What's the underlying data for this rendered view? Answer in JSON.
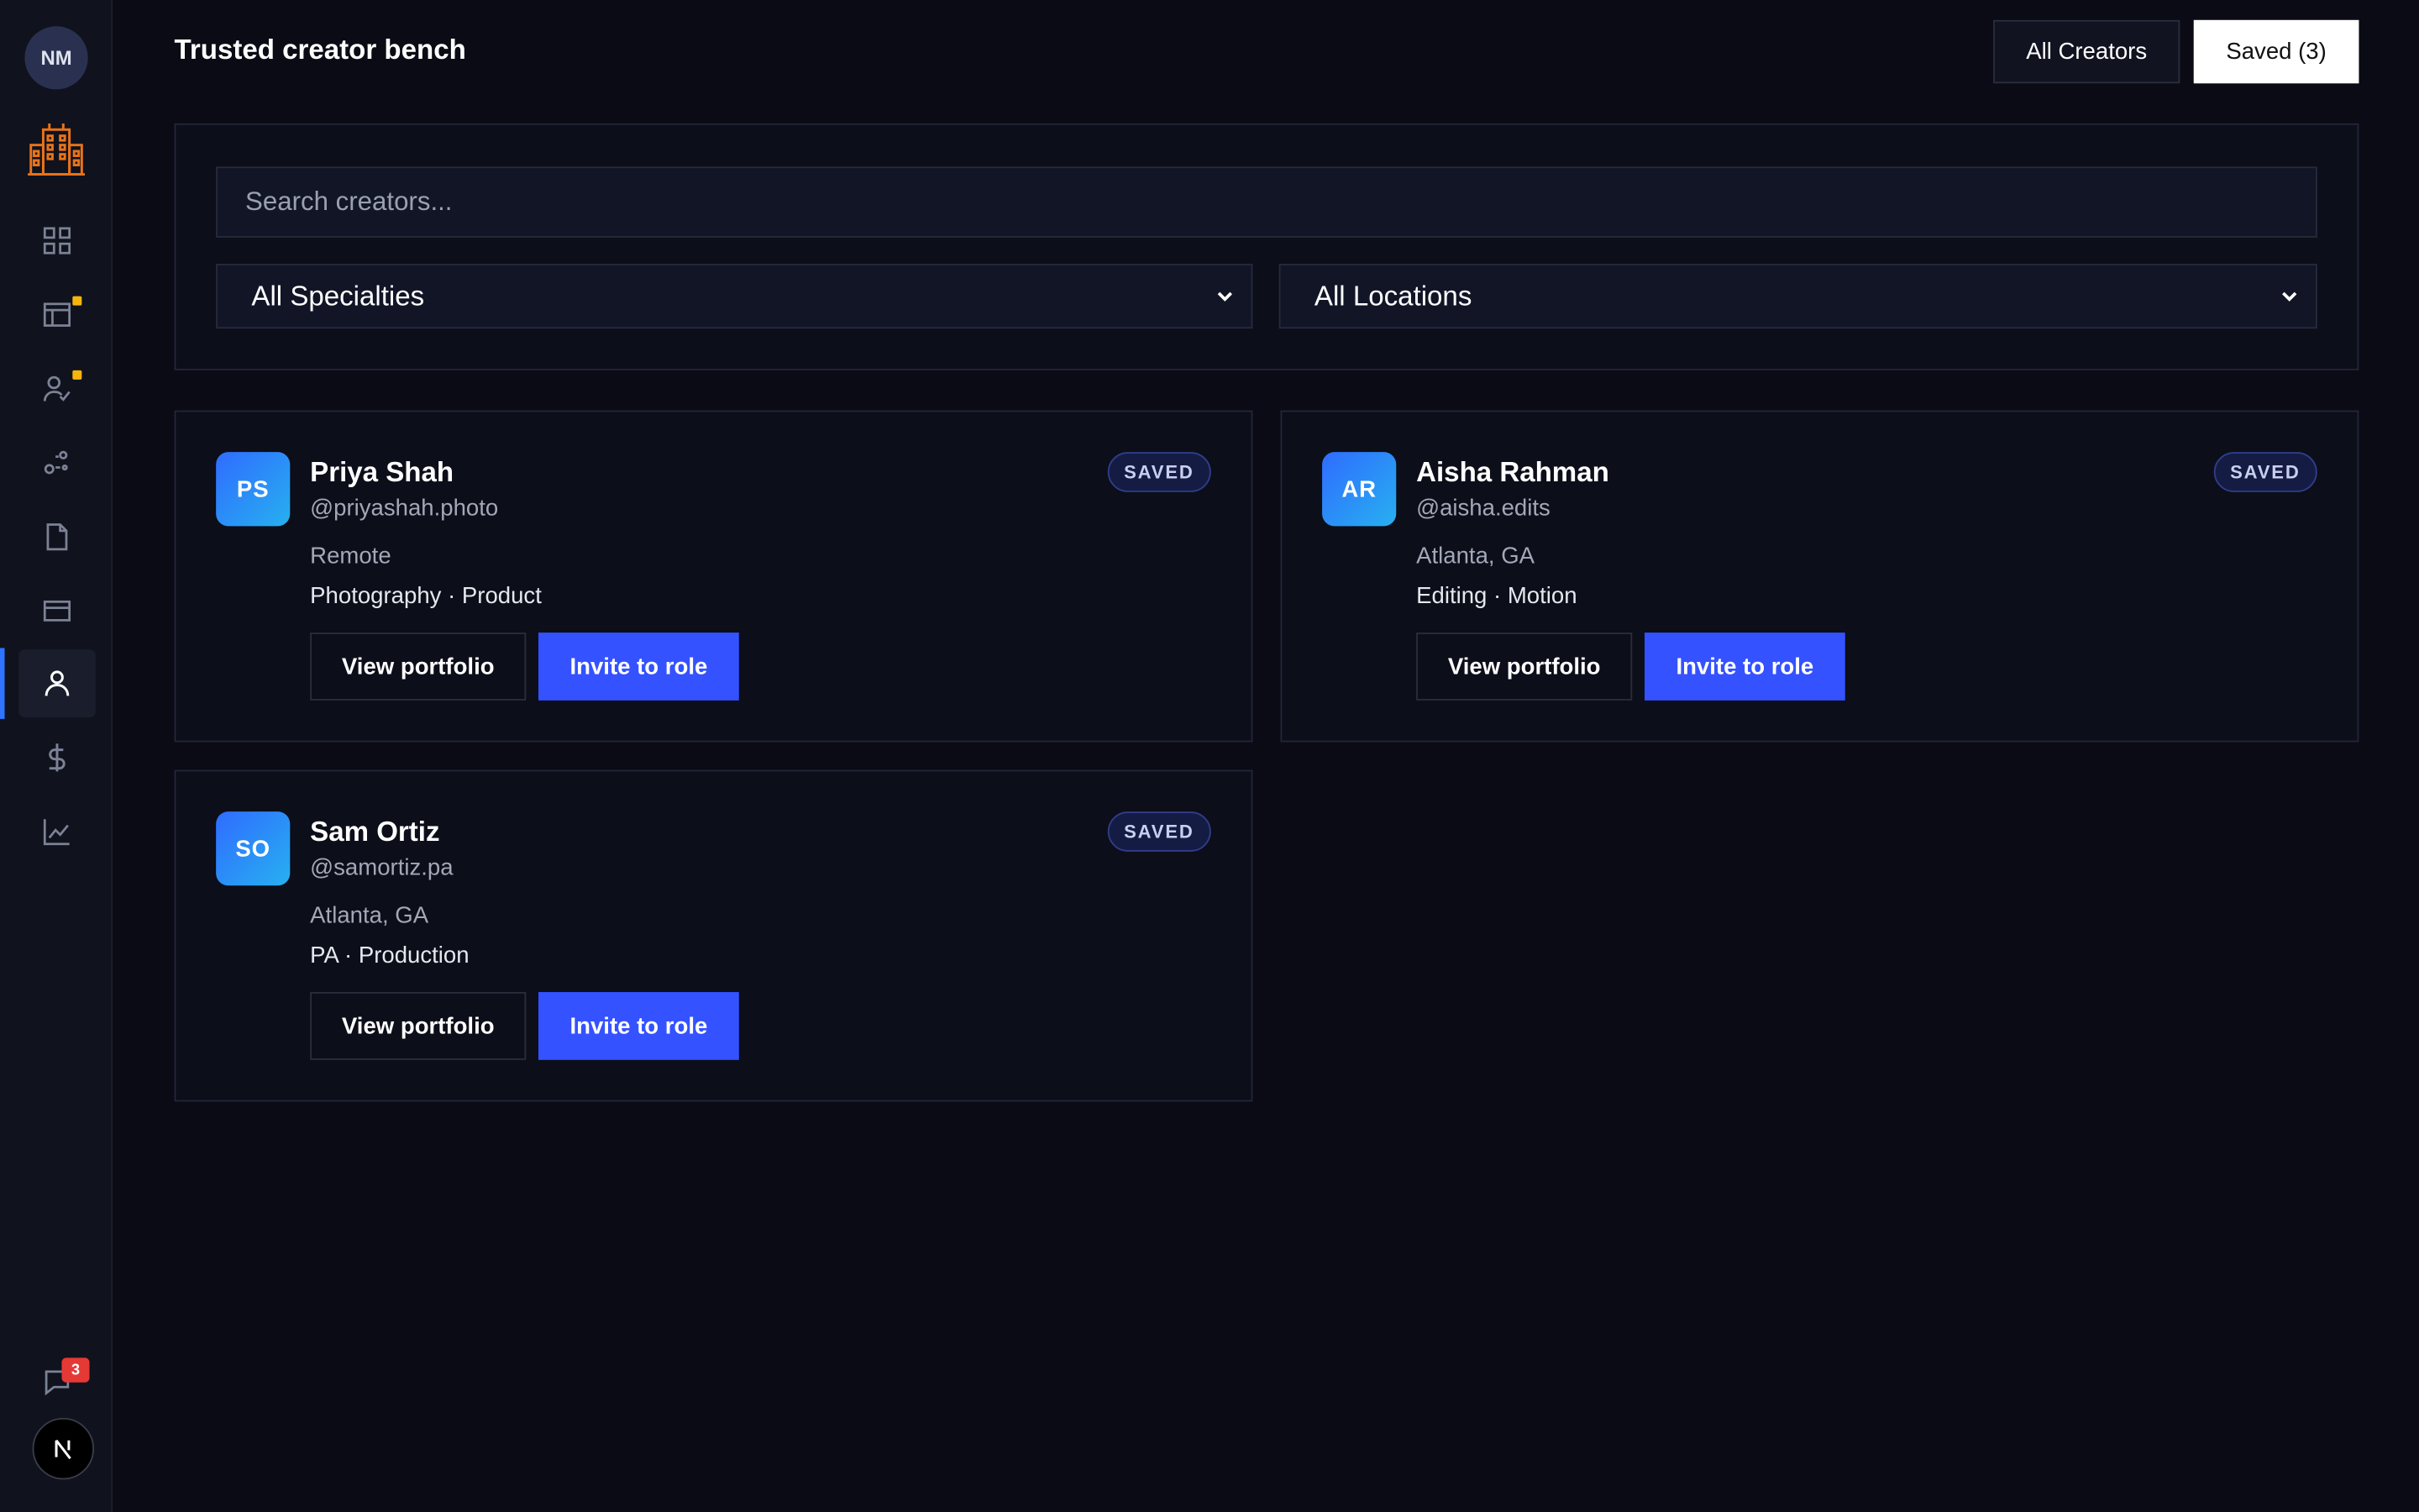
{
  "user": {
    "initials": "NM"
  },
  "header": {
    "title": "Trusted creator bench",
    "tabs": [
      {
        "label": "All Creators",
        "active": false
      },
      {
        "label": "Saved (3)",
        "active": true
      }
    ]
  },
  "filters": {
    "search_placeholder": "Search creators...",
    "specialty": "All Specialties",
    "location": "All Locations"
  },
  "nav": {
    "items": [
      {
        "icon": "grid-icon"
      },
      {
        "icon": "browser-window-icon",
        "notification": true
      },
      {
        "icon": "user-check-icon",
        "notification": true
      },
      {
        "icon": "workflow-icon"
      },
      {
        "icon": "document-icon"
      },
      {
        "icon": "credit-card-icon"
      },
      {
        "icon": "user-icon",
        "active": true
      },
      {
        "icon": "dollar-icon"
      },
      {
        "icon": "line-chart-icon"
      }
    ],
    "chat_count": "3"
  },
  "creators": [
    {
      "initials": "PS",
      "name": "Priya Shah",
      "handle": "@priyashah.photo",
      "location": "Remote",
      "specialties": "Photography · Product",
      "badge": "SAVED",
      "view_label": "View portfolio",
      "invite_label": "Invite to role"
    },
    {
      "initials": "AR",
      "name": "Aisha Rahman",
      "handle": "@aisha.edits",
      "location": "Atlanta, GA",
      "specialties": "Editing · Motion",
      "badge": "SAVED",
      "view_label": "View portfolio",
      "invite_label": "Invite to role"
    },
    {
      "initials": "SO",
      "name": "Sam Ortiz",
      "handle": "@samortiz.pa",
      "location": "Atlanta, GA",
      "specialties": "PA · Production",
      "badge": "SAVED",
      "view_label": "View portfolio",
      "invite_label": "Invite to role"
    }
  ],
  "colors": {
    "accent": "#3452ff",
    "active_indicator": "#2f74ff",
    "notification_dot": "#f5b60b",
    "badge_red": "#e53935",
    "brand_logo": "#e8731a"
  }
}
